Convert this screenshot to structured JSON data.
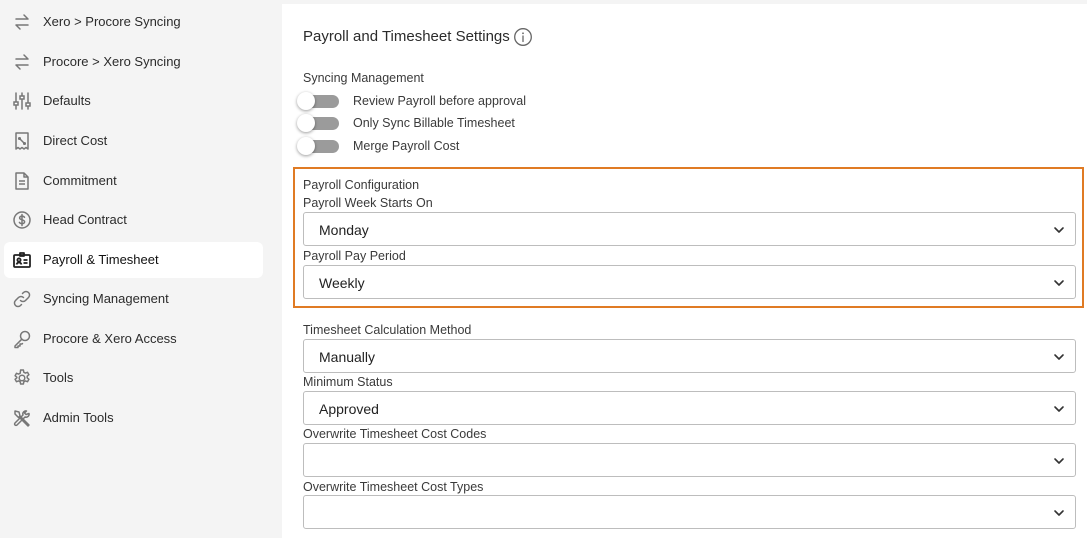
{
  "sidebar": {
    "items": [
      {
        "label": "Xero > Procore Syncing",
        "icon": "arrows-swap-icon"
      },
      {
        "label": "Procore > Xero Syncing",
        "icon": "arrows-swap-icon"
      },
      {
        "label": "Defaults",
        "icon": "sliders-icon"
      },
      {
        "label": "Direct Cost",
        "icon": "receipt-icon"
      },
      {
        "label": "Commitment",
        "icon": "document-icon"
      },
      {
        "label": "Head Contract",
        "icon": "dollar-circle-icon"
      },
      {
        "label": "Payroll & Timesheet",
        "icon": "id-card-icon",
        "active": true
      },
      {
        "label": "Syncing Management",
        "icon": "link-icon"
      },
      {
        "label": "Procore & Xero Access",
        "icon": "key-icon"
      },
      {
        "label": "Tools",
        "icon": "gear-icon"
      },
      {
        "label": "Admin Tools",
        "icon": "tools-icon"
      }
    ]
  },
  "panel": {
    "title": "Payroll and Timesheet Settings",
    "syncing_management": {
      "label": "Syncing Management",
      "toggles": [
        {
          "label": "Review Payroll before approval",
          "on": false
        },
        {
          "label": "Only Sync Billable Timesheet",
          "on": false
        },
        {
          "label": "Merge Payroll Cost",
          "on": false
        }
      ]
    },
    "payroll_configuration": {
      "label": "Payroll Configuration",
      "week_starts_label": "Payroll Week Starts On",
      "week_starts_value": "Monday",
      "pay_period_label": "Payroll Pay Period",
      "pay_period_value": "Weekly"
    },
    "timesheet_calc_label": "Timesheet Calculation Method",
    "timesheet_calc_value": "Manually",
    "minimum_status_label": "Minimum Status",
    "minimum_status_value": "Approved",
    "overwrite_cost_codes_label": "Overwrite Timesheet Cost Codes",
    "overwrite_cost_codes_value": "",
    "overwrite_cost_types_label": "Overwrite Timesheet Cost Types",
    "overwrite_cost_types_value": ""
  },
  "colors": {
    "highlight": "#e07b24",
    "toggle_off": "#9b9b9b"
  }
}
